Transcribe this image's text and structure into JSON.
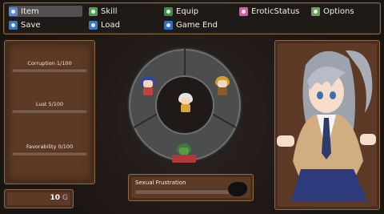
{
  "menu": {
    "item": "Item",
    "skill": "Skill",
    "equip": "Equip",
    "erotic_status": "EroticStatus",
    "options": "Options",
    "save": "Save",
    "load": "Load",
    "game_end": "Game End"
  },
  "stats": {
    "corruption": "Corruption  1/100",
    "lust": "Lust  5/100",
    "favorability": "Favorability  0/100"
  },
  "gold": {
    "value": "10",
    "unit": "G"
  },
  "frustration": {
    "label": "Sexual Frustration"
  },
  "colors": {
    "panel_brown": "#5c3a25",
    "panel_border": "#8c6a4a",
    "menu_bg": "#1e1a18",
    "ring_stone": "#4b4d4e"
  },
  "icons": {
    "item": "potion-icon",
    "skill": "book-icon",
    "equip": "armor-icon",
    "erotic_status": "heart-icon",
    "options": "gear-icon",
    "save": "quill-icon",
    "load": "quill-icon",
    "game_end": "exit-icon"
  }
}
